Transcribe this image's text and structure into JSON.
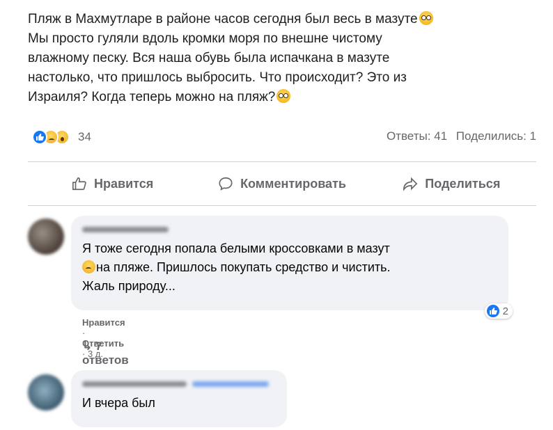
{
  "post": {
    "text_lines": [
      "Пляж в Махмутларе в районе часов сегодня был весь в мазуте",
      "Мы просто гуляли вдоль кромки моря по внешне чистому",
      "влажному песку. Вся наша обувь была испачкана в мазуте",
      "настолько, что пришлось выбросить. Что происходит? Это из",
      "Израиля? Когда теперь можно на пляж?"
    ],
    "reaction_icons": [
      "like-icon",
      "sad-icon",
      "wow-icon"
    ],
    "reaction_count": "34",
    "comments_count": "Ответы: 41",
    "shares_count": "Поделились: 1"
  },
  "actions": {
    "like_label": "Нравится",
    "comment_label": "Комментировать",
    "share_label": "Поделиться"
  },
  "comments": [
    {
      "text_line1": "Я тоже сегодня попала белыми кроссовками в мазут",
      "text_line2": "на пляже. Пришлось покупать средство и чистить.",
      "text_line3": "Жаль природу...",
      "reaction_count": "2",
      "like_action": "Нравится",
      "reply_action": "Ответить",
      "time": "3 д.",
      "replies_label": "7 ответов"
    },
    {
      "text": "И вчера был"
    }
  ],
  "colors": {
    "accent": "#1877f2",
    "muted": "#65676b",
    "bubble": "#f0f2f5"
  }
}
